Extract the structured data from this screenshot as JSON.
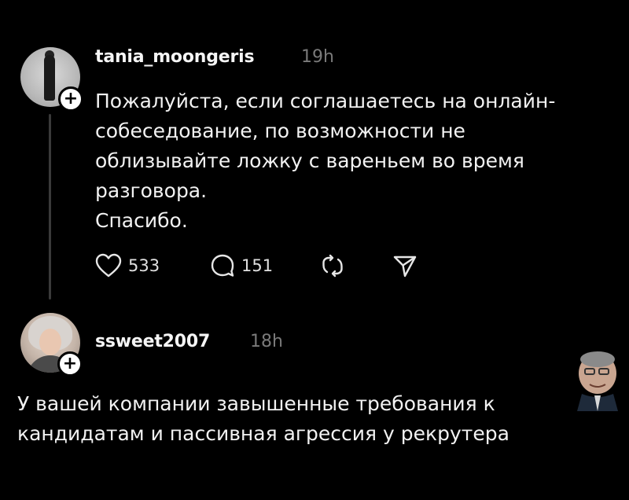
{
  "post": {
    "username": "tania_moongeris",
    "time": "19h",
    "text": "Пожалуйста, если соглашаетесь на онлайн-\nсобеседование, по возможности не\nоблизывайте ложку с вареньем во время\nразговора.\nСпасибо.",
    "likes": "533",
    "comments": "151"
  },
  "reply": {
    "username": "ssweet2007",
    "time": "18h",
    "text": "У вашей компании завышенные требования к\nкандидатам и пассивная агрессия у рекрутера"
  },
  "icons": {
    "like": "heart-icon",
    "comment": "comment-bubble-icon",
    "repost": "repost-icon",
    "share": "send-icon",
    "follow": "plus-icon"
  },
  "colors": {
    "background": "#000000",
    "text": "#f2f2f2",
    "muted": "#7a7a7a"
  }
}
